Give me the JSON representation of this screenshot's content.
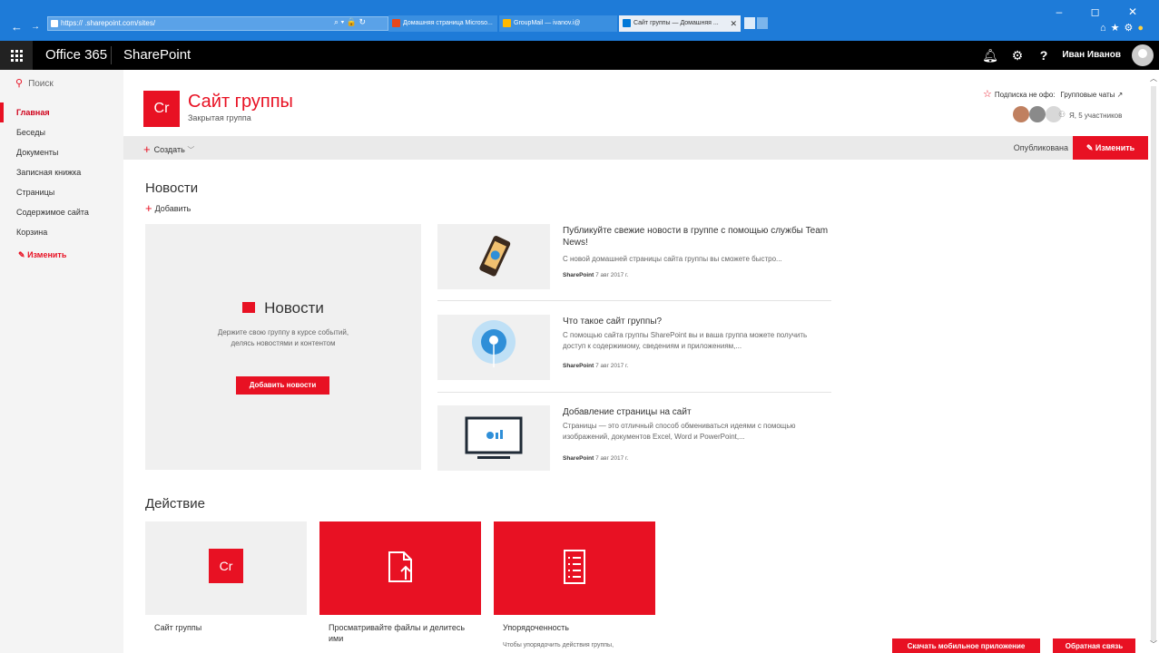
{
  "browser": {
    "url": "https://          .sharepoint.com/sites/          ",
    "tabs": [
      {
        "label": "Домашняя страница Microso..."
      },
      {
        "label": "GroupMail — ivanov.i@          "
      },
      {
        "label": "Сайт группы — Домашняя ..."
      }
    ],
    "window_controls": "–  ◻  ✕",
    "tab_close": "✕",
    "colors": {
      "chrome": "#1e7bd8"
    }
  },
  "suite": {
    "app": "Office 365",
    "product": "SharePoint",
    "user": "Иван Иванов",
    "help": "?"
  },
  "nav": {
    "search": "Поиск",
    "items": [
      {
        "label": "Главная"
      },
      {
        "label": "Беседы"
      },
      {
        "label": "Документы"
      },
      {
        "label": "Записная книжка"
      },
      {
        "label": "Страницы"
      },
      {
        "label": "Содержимое сайта"
      },
      {
        "label": "Корзина"
      }
    ],
    "edit": "Изменить"
  },
  "site": {
    "logo": "Cr",
    "title": "Сайт группы",
    "subtitle": "Закрытая группа",
    "follow": "Подписка не офо:",
    "group_chats": "Групповые чаты ↗",
    "members": "Я, 5 участников"
  },
  "commandbar": {
    "create": "Создать",
    "published": "Опубликована",
    "edit": "Изменить"
  },
  "news": {
    "heading": "Новости",
    "add": "Добавить",
    "hero": {
      "title": "Новости",
      "text": "Держите свою группу в курсе событий, делясь новостями и контентом",
      "button": "Добавить новости"
    },
    "items": [
      {
        "title": "Публикуйте свежие новости в группе с помощью службы Team News!",
        "desc": "С новой домашней страницы сайта группы вы сможете быстро...",
        "author": "SharePoint",
        "date": "7 авг 2017 г."
      },
      {
        "title": "Что такое сайт группы?",
        "desc": "С помощью сайта группы SharePoint вы и ваша группа можете получить доступ к содержимому, сведениям и приложениям,...",
        "author": "SharePoint",
        "date": "7 авг 2017 г."
      },
      {
        "title": "Добавление страницы на сайт",
        "desc": "Страницы — это отличный способ обмениваться идеями с помощью изображений, документов Excel, Word и PowerPoint,...",
        "author": "SharePoint",
        "date": "7 авг 2017 г."
      }
    ]
  },
  "activity": {
    "heading": "Действие",
    "cards": [
      {
        "label": "Сайт группы",
        "logo": "Cr",
        "desc": ""
      },
      {
        "label": "Просматривайте файлы и делитесь ими",
        "desc": ""
      },
      {
        "label": "Упорядоченность",
        "desc": "Чтобы упорядочить действия группы,"
      }
    ]
  },
  "footer": {
    "mobile_app": "Скачать мобильное приложение",
    "feedback": "Обратная связь"
  },
  "colors": {
    "accent": "#e81123",
    "suite_bar": "#000000",
    "nav_bg": "#f4f4f4"
  }
}
